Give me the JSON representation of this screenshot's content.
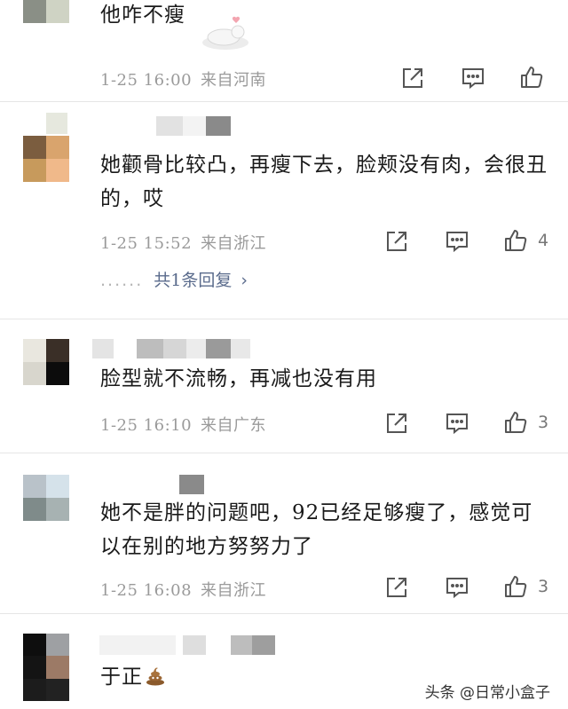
{
  "comments": [
    {
      "text": "他咋不瘦",
      "date": "1-25 16:00",
      "location": "来自河南",
      "likes": ""
    },
    {
      "text": "她颧骨比较凸，再瘦下去，脸颊没有肉，会很丑的，哎",
      "date": "1-25 15:52",
      "location": "来自浙江",
      "likes": "4",
      "replies": "共1条回复",
      "replies_dots": "......"
    },
    {
      "text": "脸型就不流畅，再减也没有用",
      "date": "1-25 16:10",
      "location": "来自广东",
      "likes": "3"
    },
    {
      "text": "她不是胖的问题吧，92已经足够瘦了，感觉可以在别的地方努努力了",
      "date": "1-25 16:08",
      "location": "来自浙江",
      "likes": "3"
    },
    {
      "text": "于正",
      "emoji": "poop-emoji"
    }
  ],
  "watermark": "头条 @日常小盒子",
  "colors": {
    "meta": "#9a9a9a",
    "reply_link": "#5a6b8c",
    "divider": "#e6e6e6"
  },
  "icons": [
    "share-icon",
    "comment-icon",
    "like-icon",
    "chevron-right-icon",
    "poop-emoji"
  ]
}
